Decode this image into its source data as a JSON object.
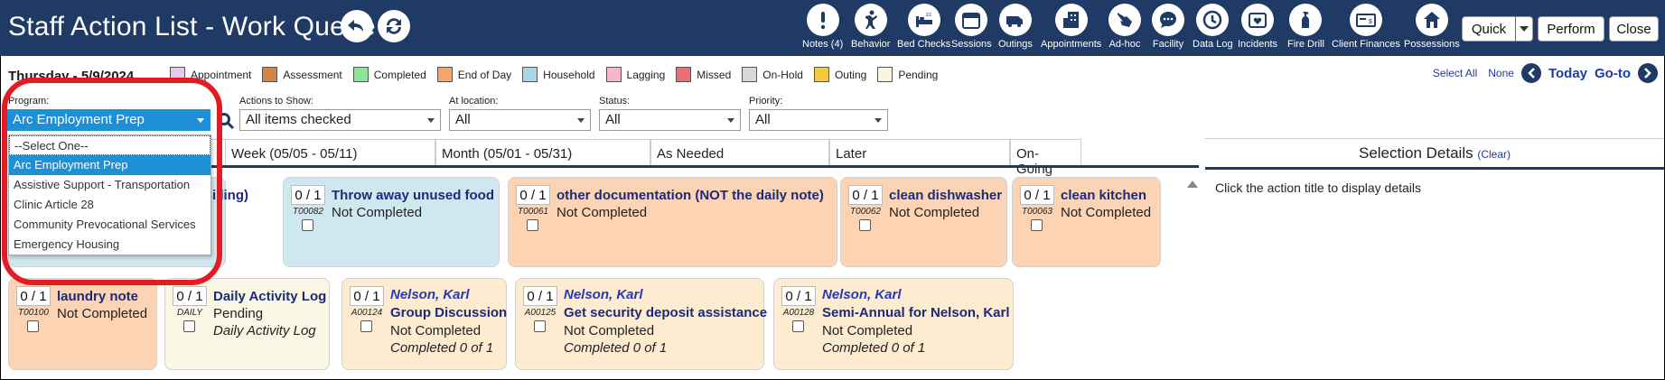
{
  "header": {
    "title": "Staff Action List - Work Queue",
    "toolbar": [
      {
        "label": "Notes (4)",
        "icon": "exclamation-icon"
      },
      {
        "label": "Behavior",
        "icon": "behavior-person-icon"
      },
      {
        "label": "Bed Checks",
        "icon": "bed-icon"
      },
      {
        "label": "Sessions",
        "icon": "calendar-icon"
      },
      {
        "label": "Outings",
        "icon": "van-icon"
      },
      {
        "label": "Appointments",
        "icon": "appointments-icon"
      },
      {
        "label": "Ad-hoc",
        "icon": "pointing-hand-icon"
      },
      {
        "label": "Facility",
        "icon": "chat-bubble-icon"
      },
      {
        "label": "Data Log",
        "icon": "clock-icon"
      },
      {
        "label": "Incidents",
        "icon": "incident-icon"
      },
      {
        "label": "Fire Drill",
        "icon": "fire-extinguisher-icon"
      },
      {
        "label": "Client Finances",
        "icon": "finances-card-icon"
      },
      {
        "label": "Possessions",
        "icon": "house-icon"
      }
    ],
    "buttons": {
      "quick": "Quick",
      "perform": "Perform",
      "close": "Close"
    }
  },
  "date": "Thursday - 5/9/2024",
  "legend": [
    {
      "label": "Appointment",
      "color": "#e7c9f0"
    },
    {
      "label": "Assessment",
      "color": "#d2854a"
    },
    {
      "label": "Completed",
      "color": "#8fe39a"
    },
    {
      "label": "End of Day",
      "color": "#f7a46c"
    },
    {
      "label": "Household",
      "color": "#a9d6e8"
    },
    {
      "label": "Lagging",
      "color": "#f7b6c9"
    },
    {
      "label": "Missed",
      "color": "#ef6e75"
    },
    {
      "label": "On-Hold",
      "color": "#d8d8d8"
    },
    {
      "label": "Outing",
      "color": "#f5cc38"
    },
    {
      "label": "Pending",
      "color": "#faf5dc"
    }
  ],
  "nav": {
    "select_all": "Select All",
    "none": "None",
    "today": "Today",
    "goto": "Go-to"
  },
  "filters": {
    "program_label": "Program:",
    "program_value": "Arc Employment Prep",
    "actions_label": "Actions to Show:",
    "actions_value": "All items checked",
    "location_label": "At location:",
    "location_value": "All",
    "status_label": "Status:",
    "status_value": "All",
    "priority_label": "Priority:",
    "priority_value": "All"
  },
  "program_options": [
    "--Select One--",
    "Arc Employment Prep",
    "Assistive Support - Transportation",
    "Clinic Article 28",
    "Community Prevocational Services",
    "Emergency Housing"
  ],
  "tabs": [
    "Week (05/05 - 05/11)",
    "Month (05/01 - 05/31)",
    "As Needed",
    "Later",
    "On-Going"
  ],
  "selection": {
    "title": "Selection Details",
    "clear": "(Clear)",
    "body": "Click the action title to display details"
  },
  "cards_row1": [
    {
      "count": "",
      "code": "",
      "title": "or Billing)",
      "status": ""
    },
    {
      "count": "0 / 1",
      "code": "T00082",
      "title": "Throw away unused food",
      "status": "Not Completed"
    },
    {
      "count": "0 / 1",
      "code": "T00061",
      "title": "other documentation (NOT the daily note)",
      "status": "Not Completed"
    },
    {
      "count": "0 / 1",
      "code": "T00062",
      "title": "clean dishwasher",
      "status": "Not Completed"
    },
    {
      "count": "0 / 1",
      "code": "T00063",
      "title": "clean kitchen",
      "status": "Not Completed"
    }
  ],
  "cards_row2": [
    {
      "count": "0 / 1",
      "code": "T00100",
      "title": "laundry note",
      "status": "Not Completed"
    },
    {
      "count": "0 / 1",
      "code": "DAILY",
      "title": "Daily Activity Log",
      "status": "Pending",
      "extra": "Daily Activity Log"
    },
    {
      "count": "0 / 1",
      "code": "A00124",
      "person": "Nelson, Karl",
      "title": "Group Discussion",
      "status": "Not Completed",
      "extra": "Completed 0 of 1"
    },
    {
      "count": "0 / 1",
      "code": "A00125",
      "person": "Nelson, Karl",
      "title": "Get security deposit assistance",
      "status": "Not Completed",
      "extra": "Completed 0 of 1"
    },
    {
      "count": "0 / 1",
      "code": "A00128",
      "person": "Nelson, Karl",
      "title": "Semi-Annual for Nelson, Karl",
      "status": "Not Completed",
      "extra": "Completed 0 of 1"
    }
  ]
}
